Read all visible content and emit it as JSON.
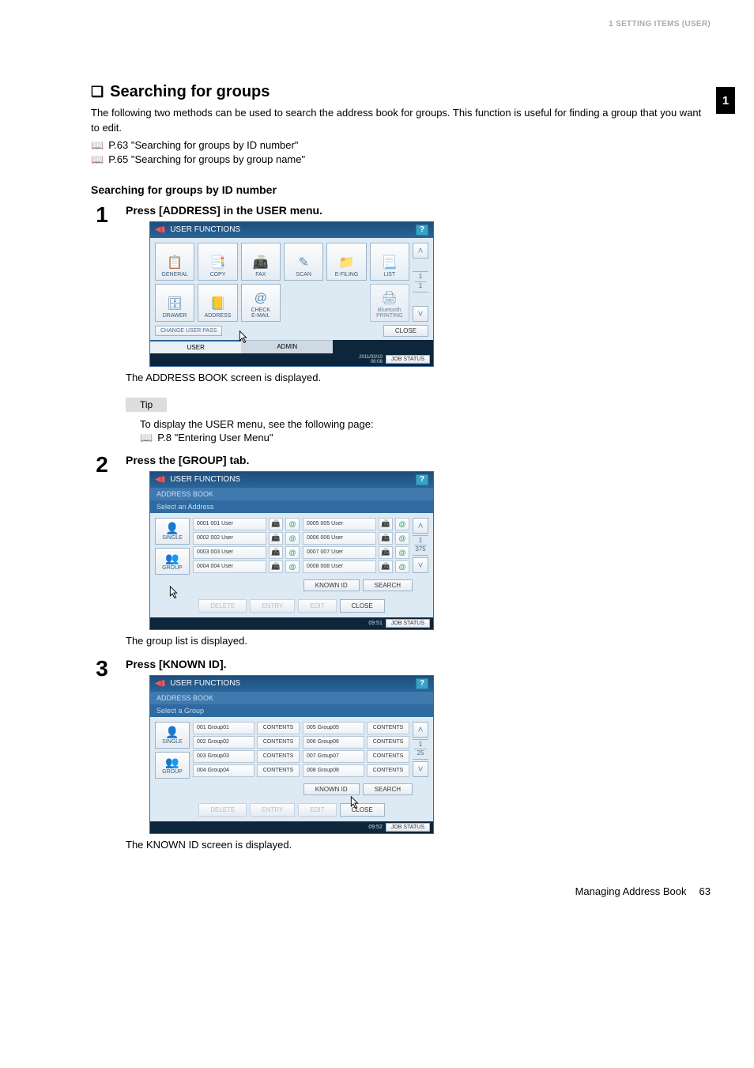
{
  "header": {
    "right": "1 SETTING ITEMS (USER)"
  },
  "side_tab": "1",
  "section": {
    "title": "Searching for groups",
    "marker": "❑",
    "intro": "The following two methods can be used to search the address book for groups. This function is useful for finding a group that you want to edit.",
    "links": [
      "P.63 \"Searching for groups by ID number\"",
      "P.65 \"Searching for groups by group name\""
    ],
    "sub_heading": "Searching for groups by ID number"
  },
  "steps": [
    {
      "num": "1",
      "instruction": "Press [ADDRESS] in the USER menu.",
      "caption": "The ADDRESS BOOK screen is displayed.",
      "tip_label": "Tip",
      "tip_text": "To display the USER menu, see the following page:",
      "tip_link": "P.8 \"Entering User Menu\""
    },
    {
      "num": "2",
      "instruction": "Press the [GROUP] tab.",
      "caption": "The group list is displayed."
    },
    {
      "num": "3",
      "instruction": "Press [KNOWN ID].",
      "caption": "The KNOWN ID screen is displayed."
    }
  ],
  "screen1": {
    "title": "USER FUNCTIONS",
    "help": "?",
    "buttons_row1": [
      "GENERAL",
      "COPY",
      "FAX",
      "SCAN",
      "E-FILING",
      "LIST"
    ],
    "buttons_row2": [
      "DRAWER",
      "ADDRESS",
      "CHECK\nE-MAIL",
      "",
      "",
      "Bluetooth\nPRINTING"
    ],
    "icons_row1": [
      "📋",
      "📑",
      "📠",
      "✎",
      "📁",
      "📃"
    ],
    "icons_row2": [
      "🗄",
      "📒",
      "@",
      "",
      "",
      "🖨"
    ],
    "page_indicator_top": "1",
    "page_indicator_bot": "1",
    "change_pass": "CHANGE USER PASS",
    "close": "CLOSE",
    "tabs": [
      "USER",
      "ADMIN"
    ],
    "datetime": "2011/03/10\n08:08",
    "jobstatus": "JOB STATUS"
  },
  "screen2": {
    "title": "USER FUNCTIONS",
    "breadcrumb": "ADDRESS BOOK",
    "subtitle": "Select an Address",
    "help": "?",
    "side": [
      {
        "icon": "👤",
        "label": "SINGLE"
      },
      {
        "icon": "👥",
        "label": "GROUP"
      }
    ],
    "rows_left": [
      {
        "id": "0001",
        "name": "001 User"
      },
      {
        "id": "0002",
        "name": "002 User"
      },
      {
        "id": "0003",
        "name": "003 User"
      },
      {
        "id": "0004",
        "name": "004 User"
      }
    ],
    "rows_right": [
      {
        "id": "0005",
        "name": "005 User"
      },
      {
        "id": "0006",
        "name": "006 User"
      },
      {
        "id": "0007",
        "name": "007 User"
      },
      {
        "id": "0008",
        "name": "008 User"
      }
    ],
    "page_top": "1",
    "page_bot": "375",
    "actions": [
      "KNOWN ID",
      "SEARCH"
    ],
    "bottom": [
      "DELETE",
      "ENTRY",
      "EDIT",
      "CLOSE"
    ],
    "time": "09:51",
    "jobstatus": "JOB STATUS"
  },
  "screen3": {
    "title": "USER FUNCTIONS",
    "breadcrumb": "ADDRESS BOOK",
    "subtitle": "Select a Group",
    "help": "?",
    "side": [
      {
        "icon": "👤",
        "label": "SINGLE"
      },
      {
        "icon": "👥",
        "label": "GROUP"
      }
    ],
    "rows_left": [
      {
        "id": "001",
        "name": "Group01"
      },
      {
        "id": "002",
        "name": "Group02"
      },
      {
        "id": "003",
        "name": "Group03"
      },
      {
        "id": "004",
        "name": "Group04"
      }
    ],
    "rows_right": [
      {
        "id": "005",
        "name": "Group05"
      },
      {
        "id": "006",
        "name": "Group06"
      },
      {
        "id": "007",
        "name": "Group07"
      },
      {
        "id": "008",
        "name": "Group08"
      }
    ],
    "contents_label": "CONTENTS",
    "page_top": "1",
    "page_bot": "25",
    "actions": [
      "KNOWN ID",
      "SEARCH"
    ],
    "bottom": [
      "DELETE",
      "ENTRY",
      "EDIT",
      "CLOSE"
    ],
    "time": "09:52",
    "jobstatus": "JOB STATUS"
  },
  "footer": {
    "title": "Managing Address Book",
    "page": "63"
  }
}
